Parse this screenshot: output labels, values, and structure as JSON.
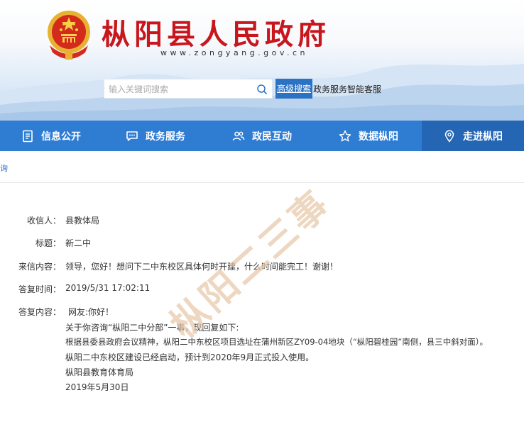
{
  "header": {
    "site_title": "枞阳县人民政府",
    "site_url": "www.zongyang.gov.cn"
  },
  "search": {
    "placeholder": "输入关键词搜索",
    "advanced_label": "高级搜索",
    "smart_service_label": "政务服务智能客服"
  },
  "nav": {
    "items": [
      {
        "label": "信息公开",
        "icon": "document-icon"
      },
      {
        "label": "政务服务",
        "icon": "chat-icon"
      },
      {
        "label": "政民互动",
        "icon": "people-icon"
      },
      {
        "label": "数据枞阳",
        "icon": "star-icon"
      },
      {
        "label": "走进枞阳",
        "icon": "location-pin-icon",
        "active": true
      }
    ]
  },
  "breadcrumb": {
    "text": "询"
  },
  "letter": {
    "recipient_label": "收信人：",
    "recipient": "县教体局",
    "subject_label": "标题：",
    "subject": "新二中",
    "content_label": "来信内容：",
    "content": "领导，您好！想问下二中东校区具体何时开建，什么时间能完工！谢谢！",
    "reply_time_label": "答复时间：",
    "reply_time": "2019/5/31 17:02:11",
    "reply_content_label": "答复内容：",
    "reply_lines": [
      "网友:你好！",
      "关于你咨询“枞阳二中分部”一事，现回复如下:",
      "根据县委县政府会议精神，枞阳二中东校区项目选址在蒲州新区ZY09-04地块（“枞阳碧桂园”南侧，县三中斜对面）。",
      "枞阳二中东校区建设已经启动，预计到2020年9月正式投入使用。",
      "枞阳县教育体育局",
      "2019年5月30日"
    ]
  },
  "watermark": {
    "text": "枞阳二三事"
  },
  "colors": {
    "title_red": "#c8161d",
    "nav_blue": "#2f7cd3",
    "nav_active": "#2466b4",
    "watermark": "#e8c9ab"
  }
}
